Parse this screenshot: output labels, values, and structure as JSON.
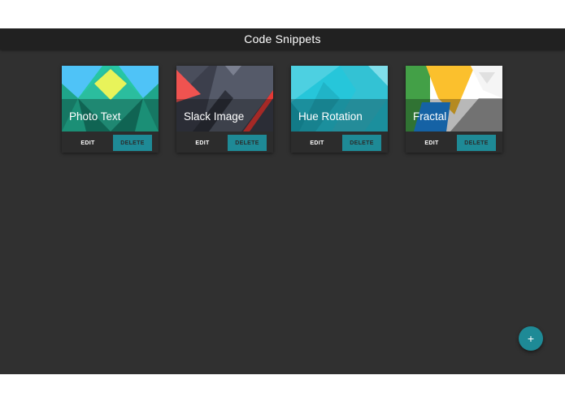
{
  "header": {
    "title": "Code Snippets"
  },
  "snippets": [
    {
      "title": "Photo Text",
      "edit_label": "EDIT",
      "delete_label": "DELETE"
    },
    {
      "title": "Slack Image",
      "edit_label": "EDIT",
      "delete_label": "DELETE"
    },
    {
      "title": "Hue Rotation",
      "edit_label": "EDIT",
      "delete_label": "DELETE"
    },
    {
      "title": "Fractal",
      "edit_label": "EDIT",
      "delete_label": "DELETE"
    }
  ],
  "fab": {
    "label": "+"
  },
  "colors": {
    "app_background": "#303030",
    "appbar_background": "#212121",
    "accent": "#1e8a96"
  }
}
